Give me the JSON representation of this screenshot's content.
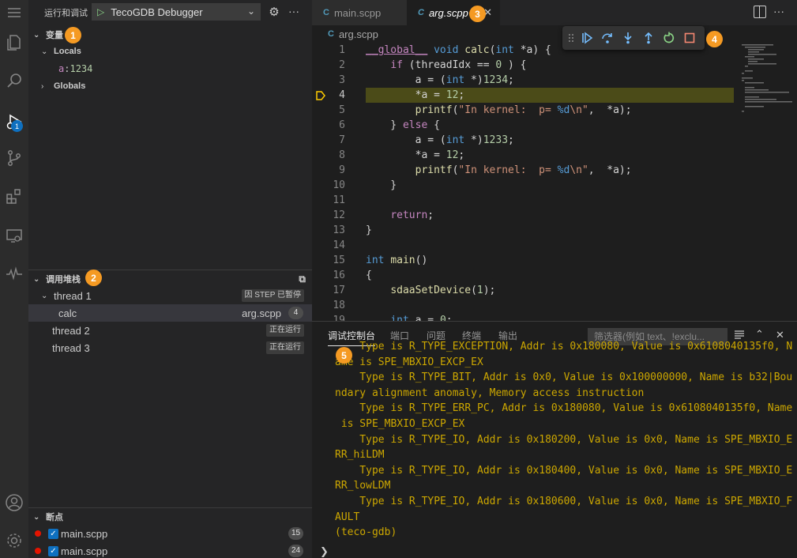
{
  "sidebar": {
    "title": "运行和调试",
    "config_name": "TecoGDB Debugger",
    "variables": {
      "title": "变量",
      "locals_label": "Locals",
      "local_var_name": "a",
      "local_var_value": "1234",
      "globals_label": "Globals"
    },
    "call_stack": {
      "title": "调用堆栈",
      "threads": [
        {
          "label": "thread 1",
          "status": "因 STEP 已暂停"
        },
        {
          "label": "thread 2",
          "status": "正在运行"
        },
        {
          "label": "thread 3",
          "status": "正在运行"
        }
      ],
      "frame": {
        "name": "calc",
        "file": "arg.scpp",
        "line": "4"
      }
    },
    "breakpoints": {
      "title": "断点",
      "items": [
        {
          "file": "main.scpp",
          "line": "15"
        },
        {
          "file": "main.scpp",
          "line": "24"
        }
      ]
    }
  },
  "activity": {
    "debug_badge": "1"
  },
  "editor": {
    "tabs": [
      {
        "label": "main.scpp",
        "active": false
      },
      {
        "label": "arg.scpp",
        "active": true
      }
    ],
    "breadcrumb": "arg.scpp",
    "current_line": 4,
    "lines": [
      {
        "n": "1",
        "html": "<span class=\"kw2\" style=\"text-decoration:underline\">__global__</span> <span class=\"kw\">void</span> <span class=\"fn\">calc</span>(<span class=\"kw\">int</span> *a) {"
      },
      {
        "n": "2",
        "html": "    <span class=\"kw2\">if</span> (threadIdx == <span class=\"num\">0</span> ) {"
      },
      {
        "n": "3",
        "html": "        a = (<span class=\"kw\">int</span> *)<span class=\"num\">1234</span>;"
      },
      {
        "n": "4",
        "html": "        *a = <span class=\"num\">12</span>;"
      },
      {
        "n": "5",
        "html": "        <span class=\"fn\">printf</span>(<span class=\"str\">\"In kernel:  p= </span><span class=\"fmt\">%d</span><span class=\"str\">\\n\"</span>,  *a);"
      },
      {
        "n": "6",
        "html": "    } <span class=\"kw2\">else</span> {"
      },
      {
        "n": "7",
        "html": "        a = (<span class=\"kw\">int</span> *)<span class=\"num\">1233</span>;"
      },
      {
        "n": "8",
        "html": "        *a = <span class=\"num\">12</span>;"
      },
      {
        "n": "9",
        "html": "        <span class=\"fn\">printf</span>(<span class=\"str\">\"In kernel:  p= </span><span class=\"fmt\">%d</span><span class=\"str\">\\n\"</span>,  *a);"
      },
      {
        "n": "10",
        "html": "    }"
      },
      {
        "n": "11",
        "html": ""
      },
      {
        "n": "12",
        "html": "    <span class=\"kw2\">return</span>;"
      },
      {
        "n": "13",
        "html": "}"
      },
      {
        "n": "14",
        "html": ""
      },
      {
        "n": "15",
        "html": "<span class=\"kw\">int</span> <span class=\"fn\">main</span>()"
      },
      {
        "n": "16",
        "html": "{"
      },
      {
        "n": "17",
        "html": "    <span class=\"fn\">sdaaSetDevice</span>(<span class=\"num\">1</span>);"
      },
      {
        "n": "18",
        "html": ""
      },
      {
        "n": "19",
        "html": "    <span class=\"kw\">int</span> a = <span class=\"num\">0</span>;"
      }
    ]
  },
  "panel": {
    "tabs": [
      "调试控制台",
      "端口",
      "问题",
      "终端",
      "输出"
    ],
    "filter_placeholder": "筛选器(例如 text、!exclu...",
    "console_lines": [
      "    Type is R_TYPE_EXCEPTION, Addr is 0x180080, Value is 0x6108040135f0, N",
      "ame is SPE_MBXIO_EXCP_EX",
      "    Type is R_TYPE_BIT, Addr is 0x0, Value is 0x100000000, Name is b32|Bou",
      "ndary alignment anomaly, Memory access instruction",
      "    Type is R_TYPE_ERR_PC, Addr is 0x180080, Value is 0x6108040135f0, Name",
      " is SPE_MBXIO_EXCP_EX",
      "    Type is R_TYPE_IO, Addr is 0x180200, Value is 0x0, Name is SPE_MBXIO_E",
      "RR_hiLDM",
      "    Type is R_TYPE_IO, Addr is 0x180400, Value is 0x0, Name is SPE_MBXIO_E",
      "RR_lowLDM",
      "    Type is R_TYPE_IO, Addr is 0x180600, Value is 0x0, Name is SPE_MBXIO_F",
      "AULT",
      "(teco-gdb)"
    ],
    "prompt": "❯"
  },
  "annotations": [
    "1",
    "2",
    "3",
    "4",
    "5"
  ],
  "colors": {
    "accent": "#0e70c0",
    "badge": "#f59a23",
    "current_line": "#4b4b18",
    "console_text": "#cca700"
  }
}
